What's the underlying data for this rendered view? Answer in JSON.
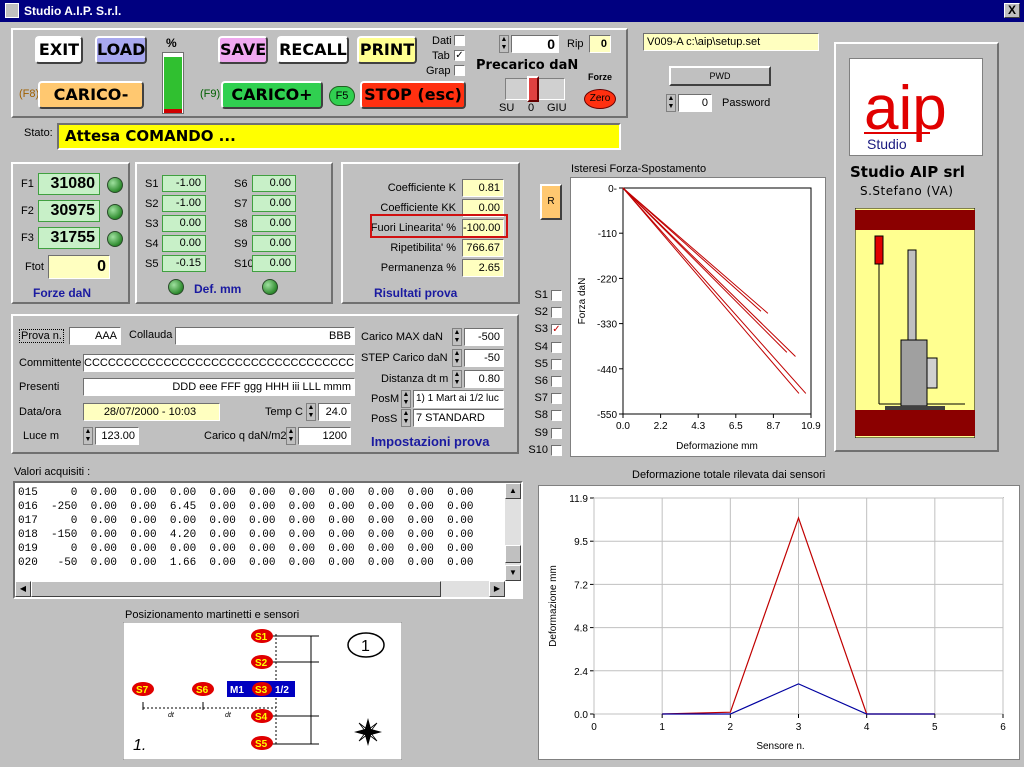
{
  "window": {
    "title": "Studio A.I.P.  S.r.l.",
    "close_label": "X"
  },
  "toolbar": {
    "exit": "EXIT",
    "load": "LOAD",
    "save": "SAVE",
    "recall": "RECALL",
    "print": "PRINT",
    "percent_label": "%",
    "carico_minus_key": "(F8)",
    "carico_minus": "CARICO-",
    "carico_plus_key": "(F9)",
    "carico_plus": "CARICO+",
    "f5_key": "F5",
    "stop": "STOP (esc)",
    "dati_label": "Dati",
    "tab_label": "Tab",
    "grap_label": "Grap",
    "tab_checked": "✓",
    "counter_value": "0",
    "rip_label": "Rip",
    "rip_value": "0",
    "precarico_label": "Precarico daN",
    "forze_label": "Forze",
    "zero_label": "Zero",
    "su_label": "SU",
    "slider_zero": "0",
    "giu_label": "GIU",
    "percent_fill": 0.92
  },
  "setup": {
    "file": "V009-A c:\\aip\\setup.set",
    "pwd_label": "PWD",
    "password_value": "0",
    "password_label": "Password"
  },
  "stato": {
    "label": "Stato:",
    "value": "Attesa COMANDO ..."
  },
  "forces": {
    "f1_label": "F1",
    "f1_value": "31080",
    "f2_label": "F2",
    "f2_value": "30975",
    "f3_label": "F3",
    "f3_value": "31755",
    "ftot_label": "Ftot",
    "ftot_value": "0",
    "title": "Forze daN"
  },
  "deformation": {
    "title": "Def. mm",
    "sensors": [
      {
        "label": "S1",
        "value": "-1.00"
      },
      {
        "label": "S2",
        "value": "-1.00"
      },
      {
        "label": "S3",
        "value": "0.00"
      },
      {
        "label": "S4",
        "value": "0.00"
      },
      {
        "label": "S5",
        "value": "-0.15"
      },
      {
        "label": "S6",
        "value": "0.00"
      },
      {
        "label": "S7",
        "value": "0.00"
      },
      {
        "label": "S8",
        "value": "0.00"
      },
      {
        "label": "S9",
        "value": "0.00"
      },
      {
        "label": "S10",
        "value": "0.00"
      }
    ]
  },
  "results": {
    "title": "Risultati prova",
    "rows": [
      {
        "label": "Coefficiente K",
        "value": "0.81"
      },
      {
        "label": "Coefficiente KK",
        "value": "0.00"
      },
      {
        "label": "Fuori Linearita' %",
        "value": "-100.00"
      },
      {
        "label": "Ripetibilita' %",
        "value": "766.67"
      },
      {
        "label": "Permanenza %",
        "value": "2.65"
      }
    ]
  },
  "settings": {
    "title": "Impostazioni prova",
    "prova_label": "Prova n.",
    "prova_value": "AAA",
    "collauda_label": "Collauda",
    "collauda_value": "BBB",
    "committente_label": "Committente",
    "committente_value": "CCCCCCCCCCCCCCCCCCCCCCCCCCCCCCCCCC",
    "presenti_label": "Presenti",
    "presenti_value": "DDD eee FFF ggg HHH iii LLL mmm",
    "dataora_label": "Data/ora",
    "dataora_value": "28/07/2000 - 10:03",
    "tempc_label": "Temp C",
    "tempc_value": "24.0",
    "luce_label": "Luce m",
    "luce_value": "123.00",
    "caricoq_label": "Carico q daN/m2",
    "caricoq_value": "1200",
    "caricomax_label": "Carico MAX daN",
    "caricomax_value": "-500",
    "step_label": "STEP Carico daN",
    "step_value": "-50",
    "distanza_label": "Distanza dt m",
    "distanza_value": "0.80",
    "posm_label": "PosM",
    "posm_value": "1) 1 Mart ai 1/2 luc",
    "poss_label": "PosS",
    "poss_value": "7  STANDARD"
  },
  "acquired": {
    "label": "Valori acquisiti :",
    "rows": [
      "015     0  0.00  0.00  0.00  0.00  0.00  0.00  0.00  0.00  0.00  0.00",
      "016  -250  0.00  0.00  6.45  0.00  0.00  0.00  0.00  0.00  0.00  0.00",
      "017     0  0.00  0.00  0.00  0.00  0.00  0.00  0.00  0.00  0.00  0.00",
      "018  -150  0.00  0.00  4.20  0.00  0.00  0.00  0.00  0.00  0.00  0.00",
      "019     0  0.00  0.00  0.00  0.00  0.00  0.00  0.00  0.00  0.00  0.00",
      "020   -50  0.00  0.00  1.66  0.00  0.00  0.00  0.00  0.00  0.00  0.00"
    ]
  },
  "positioning": {
    "title": "Posizionamento martinetti e sensori",
    "s1": "S1",
    "s2": "S2",
    "s3": "S3",
    "s4": "S4",
    "s5": "S5",
    "s6": "S6",
    "s7": "S7",
    "m1": "M1",
    "half": "1/2",
    "dt": "dt",
    "circle_num": "1",
    "corner_num": "1."
  },
  "sensor_checks": {
    "r_label": "R",
    "items": [
      "S1",
      "S2",
      "S3",
      "S4",
      "S5",
      "S6",
      "S7",
      "S8",
      "S9",
      "S10"
    ],
    "checked": "S3"
  },
  "logo": {
    "aip": "aip",
    "studio": "Studio",
    "company": "Studio AIP srl",
    "location": "S.Stefano (VA)"
  },
  "chart_data": [
    {
      "type": "line",
      "title": "Isteresi Forza-Spostamento",
      "xlabel": "Deformazione mm",
      "ylabel": "Forza daN",
      "xlim": [
        0,
        10.9
      ],
      "ylim": [
        -550,
        0
      ],
      "xticks": [
        "0.0",
        "2.2",
        "4.3",
        "6.5",
        "8.7",
        "10.9"
      ],
      "yticks": [
        "0-",
        "-110",
        "-220",
        "-330",
        "-440",
        "-550"
      ],
      "grid": false,
      "color": "#c00000",
      "series": [
        {
          "x": [
            0,
            10.2
          ],
          "y": [
            0,
            -500
          ]
        },
        {
          "x": [
            0,
            10.6
          ],
          "y": [
            0,
            -500
          ]
        },
        {
          "x": [
            0,
            9.5
          ],
          "y": [
            0,
            -400
          ]
        },
        {
          "x": [
            0,
            10.0
          ],
          "y": [
            0,
            -410
          ]
        },
        {
          "x": [
            0,
            8.0
          ],
          "y": [
            0,
            -300
          ]
        },
        {
          "x": [
            0,
            8.4
          ],
          "y": [
            0,
            -305
          ]
        }
      ]
    },
    {
      "type": "line",
      "title": "Deformazione totale rilevata dai sensori",
      "xlabel": "Sensore n.",
      "ylabel": "Deformazione mm",
      "xlim": [
        0,
        6
      ],
      "ylim": [
        0,
        11.9
      ],
      "xticks": [
        "0",
        "1",
        "2",
        "3",
        "4",
        "5",
        "6"
      ],
      "yticks": [
        "0.0",
        "2.4",
        "4.8",
        "7.2",
        "9.5",
        "11.9"
      ],
      "grid": true,
      "series": [
        {
          "color": "#c00000",
          "x": [
            1,
            2,
            3,
            4,
            5
          ],
          "y": [
            0.0,
            0.1,
            10.8,
            0.0,
            0.0
          ]
        },
        {
          "color": "#0000a0",
          "x": [
            1,
            2,
            3,
            4,
            5
          ],
          "y": [
            0.0,
            0.0,
            1.66,
            0.0,
            0.0
          ]
        }
      ]
    }
  ]
}
